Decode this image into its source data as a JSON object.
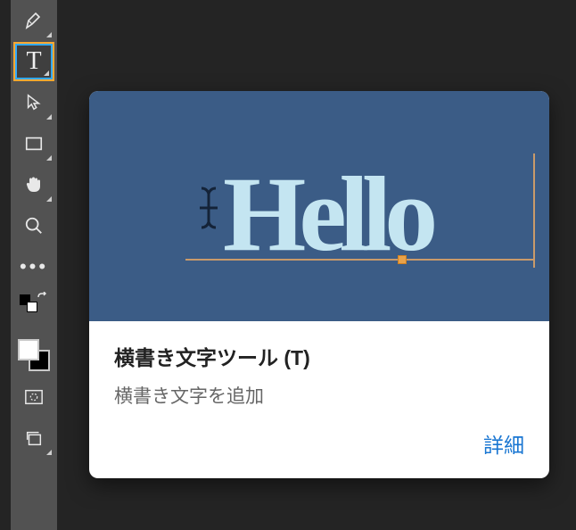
{
  "tools": {
    "pen": "pen",
    "type": "T",
    "path": "path-selection",
    "rect": "rectangle",
    "hand": "hand",
    "zoom": "zoom",
    "more": "•••"
  },
  "tooltip": {
    "previewText": "Hello",
    "title": "横書き文字ツール (T)",
    "desc": "横書き文字を追加",
    "learnMore": "詳細"
  }
}
